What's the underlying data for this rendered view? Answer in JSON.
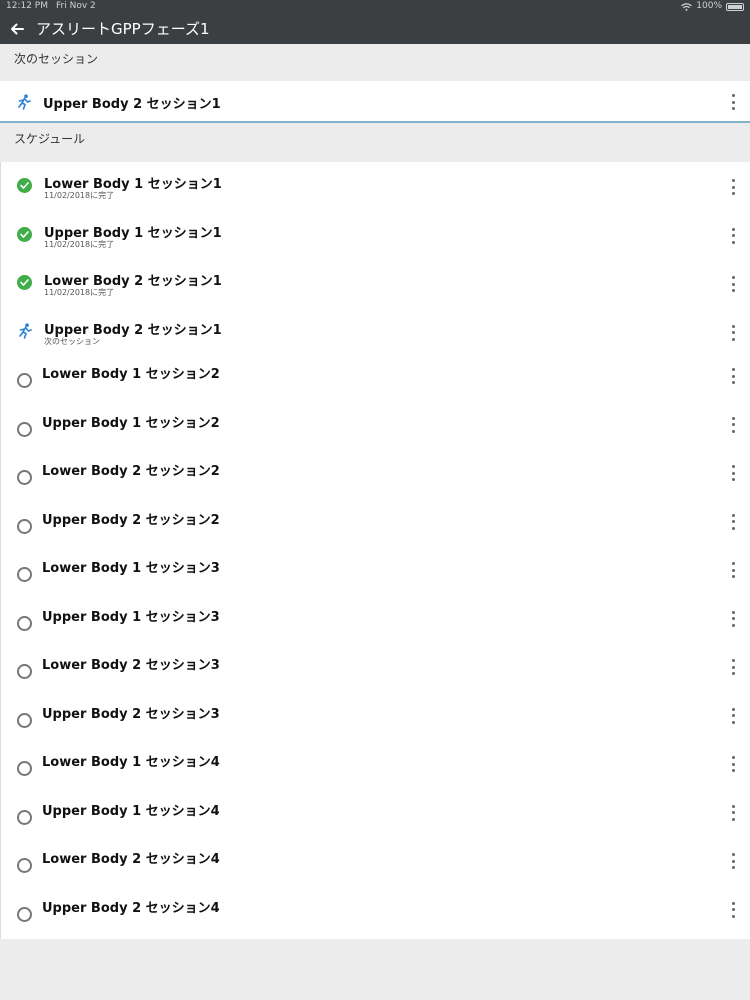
{
  "status_bar": {
    "time": "12:12 PM",
    "date": "Fri Nov 2",
    "battery": "100%"
  },
  "app_bar": {
    "title": "アスリートGPPフェーズ1"
  },
  "next_section": {
    "header": "次のセッション",
    "item": {
      "title": "Upper Body 2 セッション1"
    }
  },
  "schedule": {
    "header": "スケジュール",
    "items": [
      {
        "title": "Lower Body 1 セッション1",
        "subtitle": "11/02/2018に完了",
        "status": "completed"
      },
      {
        "title": "Upper Body 1 セッション1",
        "subtitle": "11/02/2018に完了",
        "status": "completed"
      },
      {
        "title": "Lower Body 2 セッション1",
        "subtitle": "11/02/2018に完了",
        "status": "completed"
      },
      {
        "title": "Upper Body 2 セッション1",
        "subtitle": "次のセッション",
        "status": "next"
      },
      {
        "title": "Lower Body 1 セッション2",
        "subtitle": "",
        "status": "pending"
      },
      {
        "title": "Upper Body 1 セッション2",
        "subtitle": "",
        "status": "pending"
      },
      {
        "title": "Lower Body 2 セッション2",
        "subtitle": "",
        "status": "pending"
      },
      {
        "title": "Upper Body 2 セッション2",
        "subtitle": "",
        "status": "pending"
      },
      {
        "title": "Lower Body 1 セッション3",
        "subtitle": "",
        "status": "pending"
      },
      {
        "title": "Upper Body 1 セッション3",
        "subtitle": "",
        "status": "pending"
      },
      {
        "title": "Lower Body 2 セッション3",
        "subtitle": "",
        "status": "pending"
      },
      {
        "title": "Upper Body 2 セッション3",
        "subtitle": "",
        "status": "pending"
      },
      {
        "title": "Lower Body 1 セッション4",
        "subtitle": "",
        "status": "pending"
      },
      {
        "title": "Upper Body 1 セッション4",
        "subtitle": "",
        "status": "pending"
      },
      {
        "title": "Lower Body 2 セッション4",
        "subtitle": "",
        "status": "pending"
      },
      {
        "title": "Upper Body 2 セッション4",
        "subtitle": "",
        "status": "pending"
      }
    ]
  },
  "icons": {
    "back": "arrow-left-icon",
    "completed": "check-circle-icon",
    "next": "runner-icon",
    "pending": "empty-circle-icon",
    "menu": "more-vertical-icon",
    "wifi": "wifi-icon",
    "battery": "battery-icon"
  },
  "colors": {
    "app_bar": "#3c3f41",
    "completed": "#3fae49",
    "next_icon": "#2b7fd6",
    "divider_accent": "#7fb3c9"
  }
}
